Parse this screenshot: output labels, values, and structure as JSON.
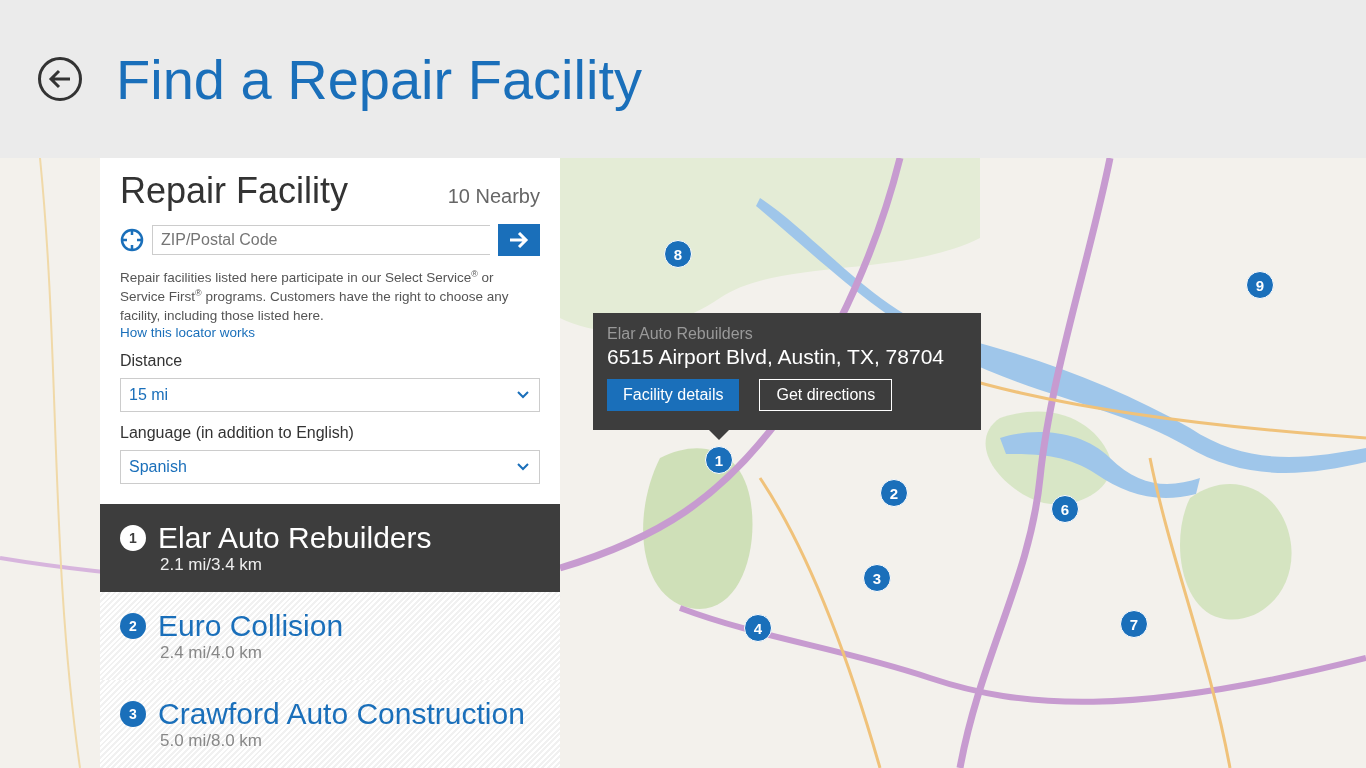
{
  "header": {
    "title": "Find a Repair Facility"
  },
  "panel": {
    "title": "Repair Facility",
    "count": "10 Nearby",
    "zip": {
      "placeholder": "ZIP/Postal Code"
    },
    "disclaimer": "Repair facilities listed here participate in our Select Service$^{®}$ or Service First$^{®}$ programs. Customers have the right to choose any facility, including those listed here.",
    "link": "How this locator works",
    "distance": {
      "label": "Distance",
      "value": "15 mi"
    },
    "language": {
      "label": "Language (in addition to English)",
      "value": "Spanish"
    }
  },
  "facilities": [
    {
      "number": "1",
      "name": "Elar Auto Rebuilders",
      "distance": "2.1 mi/3.4 km",
      "selected": true
    },
    {
      "number": "2",
      "name": "Euro Collision",
      "distance": "2.4 mi/4.0 km",
      "selected": false
    },
    {
      "number": "3",
      "name": "Crawford Auto Construction",
      "distance": "5.0 mi/8.0 km",
      "selected": false
    }
  ],
  "map": {
    "kind": "picture",
    "pins": [
      "8",
      "9",
      "1",
      "2",
      "6",
      "3",
      "7",
      "4"
    ],
    "popup": {
      "name": "Elar Auto Rebuilders",
      "address": "6515 Airport Blvd, Austin, TX, 78704",
      "buttons": [
        "Facility details",
        "Get directions"
      ]
    }
  }
}
